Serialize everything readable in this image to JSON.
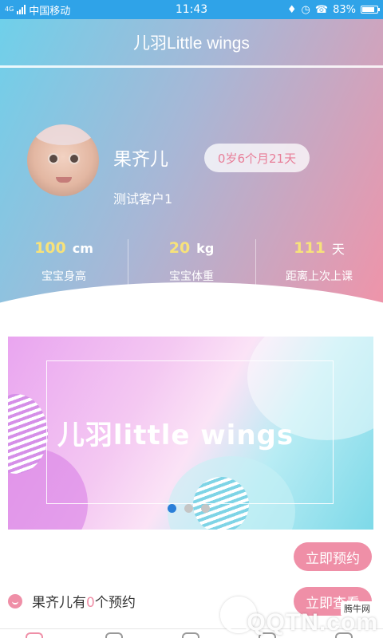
{
  "status_bar": {
    "network_tag": "4G",
    "carrier": "中国移动",
    "time": "11:43",
    "battery_percent": "83%",
    "battery_level": 0.83
  },
  "header": {
    "title": "儿羽Little wings"
  },
  "profile": {
    "child_name": "果齐儿",
    "age": "0岁6个月21天",
    "client_name": "测试客户1"
  },
  "stats": [
    {
      "value": "100",
      "unit": "cm",
      "label": "宝宝身高"
    },
    {
      "value": "20",
      "unit": "kg",
      "label": "宝宝体重"
    },
    {
      "value": "111",
      "unit": "天",
      "label": "距离上次上课"
    }
  ],
  "banner": {
    "text": "儿羽little wings",
    "active_slide": 1,
    "slide_count": 3
  },
  "actions": {
    "book_label": "立即预约",
    "view_label": "立即查看"
  },
  "appointments": {
    "prefix": "果齐儿有",
    "count": "0",
    "suffix": "个预约"
  },
  "watermark": {
    "site_label": "腾牛网",
    "logo_text": "QQTN.com"
  },
  "colors": {
    "accent_pink": "#ef8fa7",
    "status_bar_blue": "#2fa3e8",
    "stat_yellow": "#f7e27a"
  }
}
